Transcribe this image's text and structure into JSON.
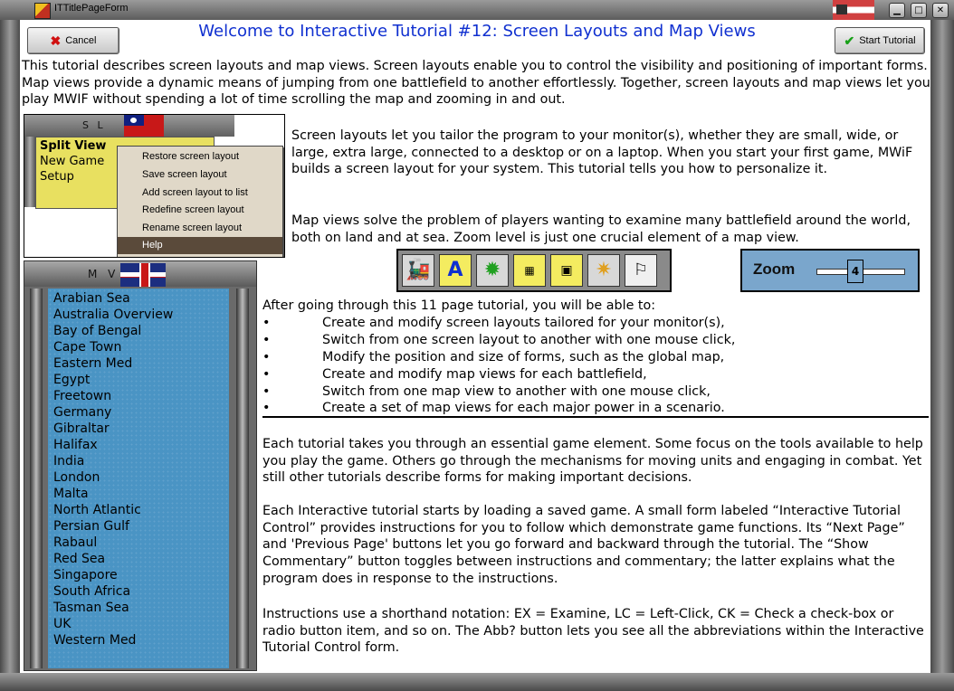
{
  "window": {
    "title": "ITTitlePageForm"
  },
  "buttons": {
    "cancel": "Cancel",
    "start": "Start Tutorial"
  },
  "heading": "Welcome to Interactive Tutorial #12: Screen Layouts and Map Views",
  "paragraphs": {
    "intro": "This tutorial describes screen layouts and map views.  Screen layouts enable you to control the visibility and positioning of important forms.  Map views provide a dynamic means of jumping from one battlefield to another effortlessly.  Together, screen layouts and map views let you play MWIF without spending a lot of time scrolling the map and zooming in and out.",
    "layouts": "Screen layouts let you tailor the program to your monitor(s), whether they are small, wide, or large, extra large, connected to a desktop or on a laptop.  When you start your first game, MWiF builds a screen layout for your system.  This tutorial tells you how to personalize it.",
    "mapviews": "Map views solve the problem of players wanting to examine many battlefield around the world, both on land and at sea.  Zoom level is just one crucial element of a map view.",
    "after": "After going through this 11 page tutorial, you will be able to:",
    "each1": "Each tutorial takes you through an essential game element.  Some focus on the tools available to help you play the game.  Others go through the mechanisms for moving units and engaging in combat.  Yet still other tutorials describe forms for making important decisions.",
    "each2": "Each Interactive tutorial starts by loading a saved game.  A small form labeled “Interactive Tutorial Control” provides instructions for you to follow which demonstrate game functions.  Its “Next Page” and 'Previous Page' buttons let you go forward and backward through the tutorial.  The “Show Commentary” button toggles between instructions and commentary; the latter explains  what the program does in response to the instructions.",
    "instr": "Instructions use a shorthand notation: EX = Examine, LC = Left-Click, CK = Check a check-box or radio button item, and so on.  The Abb? button lets you see all the abbreviations within the Interactive Tutorial Control form."
  },
  "bullets": [
    "Create and modify screen layouts tailored for your monitor(s),",
    "Switch from one screen layout to another with one mouse click,",
    "Modify the position and size of forms, such as the global map,",
    "Create and modify map views for each battlefield,",
    "Switch from one map view to another with one mouse click,",
    "Create a set of map views for each major power in a scenario."
  ],
  "split_view": {
    "caption": "S L",
    "items": [
      "Split View",
      "New Game",
      "Setup"
    ],
    "menu": [
      "Restore screen layout",
      "Save screen layout",
      "Add screen layout to list",
      "Redefine screen layout",
      "Rename screen layout",
      "Help"
    ]
  },
  "map_view": {
    "caption": "M V",
    "items": [
      "Arabian Sea",
      "Australia Overview",
      "Bay of Bengal",
      "Cape Town",
      "Eastern Med",
      "Egypt",
      "Freetown",
      "Germany",
      "Gibraltar",
      "Halifax",
      "India",
      "London",
      "Malta",
      "North Atlantic",
      "Persian Gulf",
      "Rabaul",
      "Red Sea",
      "Singapore",
      "South Africa",
      "Tasman Sea",
      "UK",
      "Western Med"
    ]
  },
  "toolbar_icons": [
    "train-icon",
    "letter-a-icon",
    "gear-icon",
    "grid-1-icon",
    "grid-2-icon",
    "sun-icon",
    "flag-icon"
  ],
  "zoom": {
    "label": "Zoom",
    "value": "4"
  }
}
